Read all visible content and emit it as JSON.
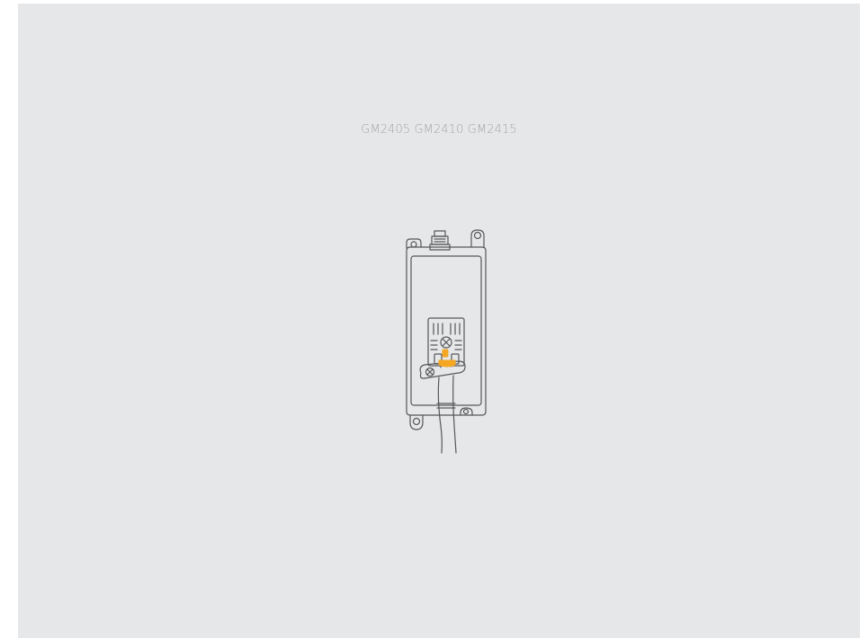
{
  "models_label": "GM2405 GM2410 GM2415",
  "illustration": {
    "subject": "device-enclosure-with-cable-gland",
    "colors": {
      "background": "#e6e7e8",
      "line": "#55575a",
      "highlight": "#f5a623",
      "text": "#a3a5a8"
    }
  }
}
